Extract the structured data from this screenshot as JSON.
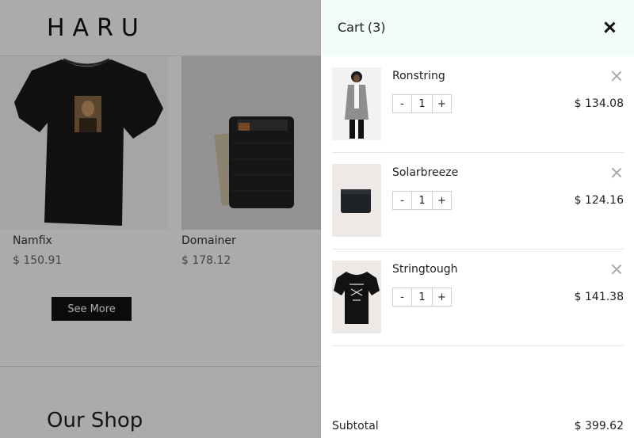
{
  "shop": {
    "logo": "HARU",
    "products": [
      {
        "name": "Namfix",
        "price": "$ 150.91"
      },
      {
        "name": "Domainer",
        "price": "$ 178.12"
      }
    ],
    "see_more_label": "See More",
    "section_title": "Our Shop"
  },
  "cart": {
    "title": "Cart",
    "count": "(3)",
    "items": [
      {
        "name": "Ronstring",
        "qty": "1",
        "price": "$ 134.08",
        "minus": "-",
        "plus": "+"
      },
      {
        "name": "Solarbreeze",
        "qty": "1",
        "price": "$ 124.16",
        "minus": "-",
        "plus": "+"
      },
      {
        "name": "Stringtough",
        "qty": "1",
        "price": "$ 141.38",
        "minus": "-",
        "plus": "+"
      }
    ],
    "subtotal_label": "Subtotal",
    "subtotal_value": "$ 399.62"
  },
  "colors": {
    "overlay": "rgba(0,0,0,0.33)",
    "cart_header_bg": "#f1fcfb",
    "button_bg": "#111111"
  }
}
